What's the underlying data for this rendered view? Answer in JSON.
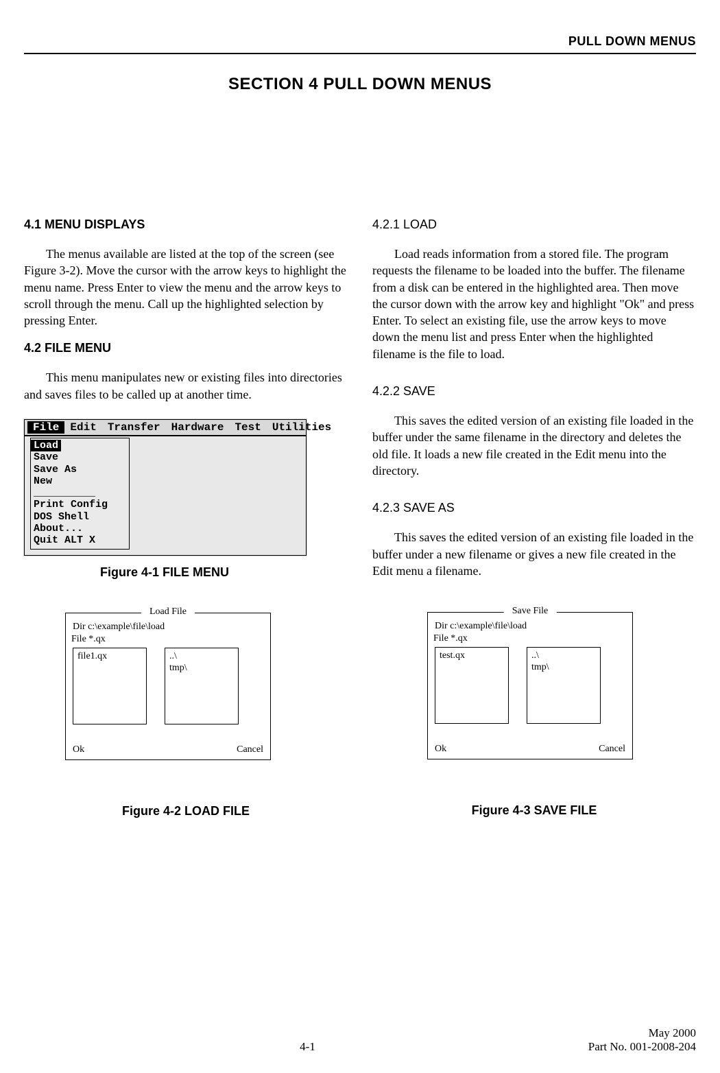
{
  "running_header": "PULL DOWN MENUS",
  "section_title": "SECTION 4   PULL DOWN MENUS",
  "left": {
    "h1_1": "4.1 MENU DISPLAYS",
    "p1": "The menus available are listed at the top of the screen (see Figure 3-2).  Move the cursor with the arrow keys to highlight the menu name.  Press Enter to view the menu and the arrow keys to scroll through the menu.  Call up the highlighted selection by pressing Enter.",
    "h1_2": "4.2 FILE MENU",
    "p2": "This menu manipulates new or existing files into directories and saves files to be called up at another time.",
    "fig1": {
      "menubar": [
        "File",
        "Edit",
        "Transfer",
        "Hardware",
        "Test",
        "Utilities"
      ],
      "dropdown": {
        "highlighted": "Load",
        "items": [
          "Save",
          "Save As",
          "New",
          "__________",
          "Print Config",
          "DOS Shell",
          "About...",
          "Quit   ALT X"
        ]
      },
      "caption": "Figure 4-1   FILE MENU"
    },
    "fig2": {
      "title": "Load File",
      "dir": "Dir c:\\example\\file\\load",
      "filelabel": "File *.qx",
      "left_pane": "file1.qx",
      "right_pane_1": "..\\",
      "right_pane_2": "tmp\\",
      "ok": "Ok",
      "cancel": "Cancel",
      "caption": "Figure 4-2   LOAD FILE"
    }
  },
  "right": {
    "h2_1": "4.2.1  LOAD",
    "p1": "Load reads information from a stored file.  The program requests the filename to be loaded into the buffer.  The filename from a disk can be entered in the highlighted area.  Then move the cursor down with the arrow key and highlight \"Ok\" and press Enter.  To select an existing file, use the arrow keys to move down the menu list and press Enter when the highlighted filename is the file to load.",
    "h2_2": "4.2.2  SAVE",
    "p2": "This saves the edited version of an existing file loaded in the buffer under the same filename in the directory and deletes the old file.  It loads a new file created in the Edit menu into the directory.",
    "h2_3": "4.2.3  SAVE AS",
    "p3": "This saves the edited version of an existing file loaded in the buffer under a new filename or gives a new file created in the Edit menu a filename.",
    "fig3": {
      "title": "Save File",
      "dir": "Dir c:\\example\\file\\load",
      "filelabel": "File *.qx",
      "left_pane": "test.qx",
      "right_pane_1": "..\\",
      "right_pane_2": "tmp\\",
      "ok": "Ok",
      "cancel": "Cancel",
      "caption": "Figure 4-3   SAVE FILE"
    }
  },
  "footer": {
    "page": "4-1",
    "date": "May 2000",
    "partno": "Part No. 001-2008-204"
  }
}
